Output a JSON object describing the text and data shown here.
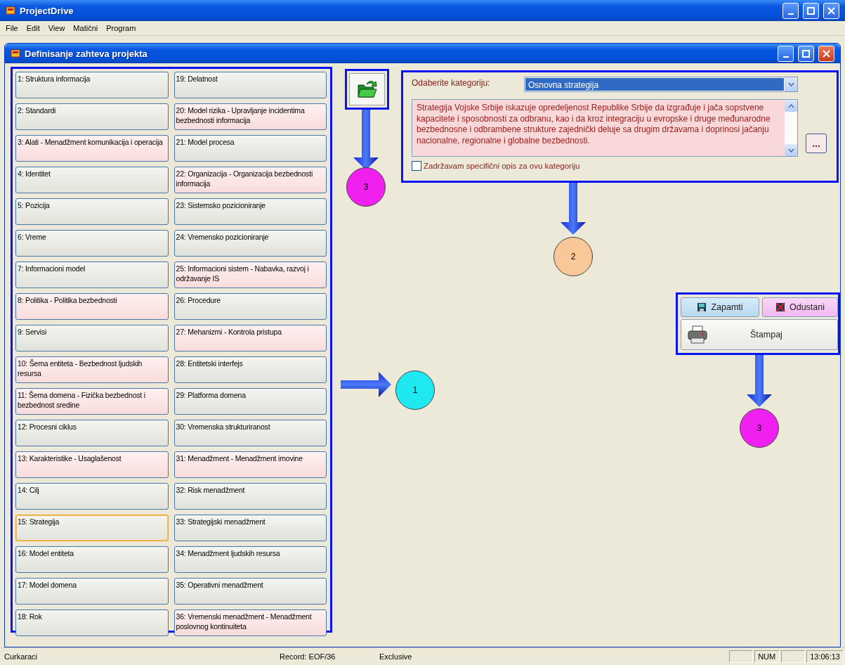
{
  "app": {
    "title": "ProjectDrive"
  },
  "menu": [
    "File",
    "Edit",
    "View",
    "Matični",
    "Program"
  ],
  "window": {
    "title": "Definisanje zahteva projekta"
  },
  "requirements": [
    {
      "label": "1: Struktura informacija",
      "tinted": false,
      "selected": false
    },
    {
      "label": "2: Standardi",
      "tinted": false,
      "selected": false
    },
    {
      "label": "3: Alati - Menadžment komunikacija i operacija",
      "tinted": true,
      "selected": false
    },
    {
      "label": "4: Identitet",
      "tinted": false,
      "selected": false
    },
    {
      "label": "5: Pozicija",
      "tinted": false,
      "selected": false
    },
    {
      "label": "6: Vreme",
      "tinted": false,
      "selected": false
    },
    {
      "label": "7: Informacioni model",
      "tinted": false,
      "selected": false
    },
    {
      "label": "8: Politika - Politika bezbednosti",
      "tinted": true,
      "selected": false
    },
    {
      "label": "9: Servisi",
      "tinted": false,
      "selected": false
    },
    {
      "label": "10: Šema entiteta - Bezbednost ljudskih resursa",
      "tinted": true,
      "selected": false
    },
    {
      "label": "11: Šema domena - Fizička bezbednost i bezbednost sredine",
      "tinted": true,
      "selected": false
    },
    {
      "label": "12: Procesni ciklus",
      "tinted": false,
      "selected": false
    },
    {
      "label": "13: Karakteristike - Usaglašenost",
      "tinted": true,
      "selected": false
    },
    {
      "label": "14: Cilj",
      "tinted": false,
      "selected": false
    },
    {
      "label": "15: Strategija",
      "tinted": false,
      "selected": true
    },
    {
      "label": "16: Model entiteta",
      "tinted": false,
      "selected": false
    },
    {
      "label": "17: Model domena",
      "tinted": false,
      "selected": false
    },
    {
      "label": "18: Rok",
      "tinted": false,
      "selected": false
    },
    {
      "label": "19: Delatnost",
      "tinted": false,
      "selected": false
    },
    {
      "label": "20: Model rizika - Upravljanje incidentima bezbednosti informacija",
      "tinted": true,
      "selected": false
    },
    {
      "label": "21: Model procesa",
      "tinted": false,
      "selected": false
    },
    {
      "label": "22: Organizacija - Organizacija bezbednosti informacija",
      "tinted": true,
      "selected": false
    },
    {
      "label": "23: Sistemsko pozicioniranje",
      "tinted": false,
      "selected": false
    },
    {
      "label": "24: Vremensko pozicioniranje",
      "tinted": false,
      "selected": false
    },
    {
      "label": "25: Informacioni sistem - Nabavka, razvoj i održavanje IS",
      "tinted": true,
      "selected": false
    },
    {
      "label": "26: Procedure",
      "tinted": false,
      "selected": false
    },
    {
      "label": "27: Mehanizmi - Kontrola pristupa",
      "tinted": true,
      "selected": false
    },
    {
      "label": "28: Entitetski interfejs",
      "tinted": false,
      "selected": false
    },
    {
      "label": "29: Platforma domena",
      "tinted": false,
      "selected": false
    },
    {
      "label": "30: Vremenska strukturiranost",
      "tinted": false,
      "selected": false
    },
    {
      "label": "31: Menadžment - Menadžment imovine",
      "tinted": true,
      "selected": false
    },
    {
      "label": "32: Risk menadžment",
      "tinted": false,
      "selected": false
    },
    {
      "label": "33: Strategijski menadžment",
      "tinted": false,
      "selected": false
    },
    {
      "label": "34: Menadžment ljudskih resursa",
      "tinted": false,
      "selected": false
    },
    {
      "label": "35: Operativni menadžment",
      "tinted": false,
      "selected": false
    },
    {
      "label": "36: Vremenski menadžment - Menadžment poslovnog kontinuiteta",
      "tinted": true,
      "selected": false
    }
  ],
  "category": {
    "label": "Odaberite kategoriju:",
    "value": "Osnovna strategija",
    "description": "Strategija Vojske Srbije iskazuje opredeljenost Republike Srbije da izgrađuje i jača sopstvene kapacitete i sposobnosti za odbranu, kao i da kroz integraciju u evropske i druge međunarodne bezbednosne i odbrambene strukture zajednički deluje sa drugim državama i doprinosi jačanju nacionalne, regionalne i globalne bezbednosti.",
    "more_button": "...",
    "keep_checkbox": {
      "label": "Zadržavam specifični opis za ovu kategoriju",
      "checked": false
    }
  },
  "actions": [
    {
      "label": "Zapamti",
      "kind": "save"
    },
    {
      "label": "Odustani",
      "kind": "cancel"
    },
    {
      "label": "Štampaj",
      "kind": "print"
    }
  ],
  "callouts": [
    {
      "label": "3",
      "color": "#f020f0"
    },
    {
      "label": "2",
      "color": "#f8c898"
    },
    {
      "label": "3",
      "color": "#f020f0"
    },
    {
      "label": "1",
      "color": "#20e8f0"
    }
  ],
  "status_bar": {
    "message": "Curkaraci",
    "record": "Record: EOF/36",
    "mode": "Exclusive",
    "num": "NUM",
    "time": "13:06:13"
  }
}
